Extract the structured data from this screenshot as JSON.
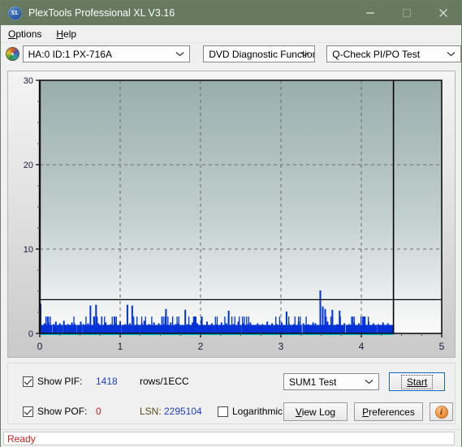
{
  "window": {
    "title": "PlexTools Professional XL V3.16",
    "icon": "xl-logo-icon",
    "minimize_label": "Minimize",
    "maximize_label": "Maximize",
    "close_label": "Close",
    "titlebar_color": "#67795F"
  },
  "menu": {
    "items": [
      {
        "label": "Options"
      },
      {
        "label": "Help"
      }
    ]
  },
  "selectors": {
    "drive_icon": "optical-disc-icon",
    "drive": {
      "value": "HA:0 ID:1  PX-716A"
    },
    "function": {
      "value": "DVD Diagnostic Functions"
    },
    "test": {
      "value": "Q-Check PI/PO Test"
    }
  },
  "chart_data": {
    "type": "bar",
    "title": "",
    "xlabel": "",
    "ylabel": "",
    "xlim": [
      0,
      5
    ],
    "ylim": [
      0,
      30
    ],
    "xticks": [
      0,
      1,
      2,
      3,
      4,
      5
    ],
    "xtick_labels": [
      "0",
      "1",
      "2",
      "3",
      "4",
      "5"
    ],
    "yticks": [
      0,
      10,
      20,
      30
    ],
    "ytick_labels": [
      "0",
      "10",
      "20",
      "30"
    ],
    "grid": true,
    "grid_style": "dashed",
    "bar_color": "#0032D8",
    "baseline_color": "#00C8D8",
    "threshold_line": {
      "value": 4,
      "color": "#000000"
    },
    "scan_end_marker": {
      "x": 4.4,
      "color": "#000000"
    },
    "series": [
      {
        "name": "PIF",
        "color": "#0032D8",
        "x": [
          0.01,
          0.03,
          0.06,
          0.09,
          0.11,
          0.14,
          0.17,
          0.2,
          0.22,
          0.25,
          0.27,
          0.3,
          0.32,
          0.35,
          0.37,
          0.4,
          0.43,
          0.45,
          0.48,
          0.51,
          0.54,
          0.57,
          0.6,
          0.63,
          0.65,
          0.68,
          0.7,
          0.73,
          0.76,
          0.79,
          0.82,
          0.85,
          0.88,
          0.91,
          0.94,
          0.97,
          1.0,
          1.03,
          1.06,
          1.09,
          1.12,
          1.15,
          1.18,
          1.21,
          1.24,
          1.27,
          1.3,
          1.33,
          1.36,
          1.39,
          1.42,
          1.45,
          1.48,
          1.51,
          1.54,
          1.57,
          1.6,
          1.63,
          1.66,
          1.69,
          1.72,
          1.75,
          1.78,
          1.81,
          1.84,
          1.87,
          1.9,
          1.93,
          1.96,
          1.99,
          2.02,
          2.05,
          2.08,
          2.11,
          2.14,
          2.17,
          2.2,
          2.23,
          2.26,
          2.29,
          2.32,
          2.35,
          2.38,
          2.41,
          2.44,
          2.47,
          2.5,
          2.53,
          2.56,
          2.59,
          2.62,
          2.65,
          2.68,
          2.71,
          2.74,
          2.77,
          2.8,
          2.83,
          2.86,
          2.89,
          2.92,
          2.95,
          2.98,
          3.01,
          3.04,
          3.07,
          3.1,
          3.13,
          3.16,
          3.19,
          3.22,
          3.25,
          3.28,
          3.31,
          3.34,
          3.37,
          3.4,
          3.43,
          3.46,
          3.49,
          3.52,
          3.55,
          3.58,
          3.61,
          3.64,
          3.67,
          3.7,
          3.73,
          3.76,
          3.79,
          3.82,
          3.85,
          3.88,
          3.91,
          3.94,
          3.97,
          4.0,
          4.03,
          4.06,
          4.09,
          4.12,
          4.15,
          4.18,
          4.21,
          4.24,
          4.27,
          4.3,
          4.33,
          4.36,
          4.39
        ],
        "values": [
          3.5,
          1,
          1.2,
          1,
          1.3,
          1,
          1.1,
          1.4,
          1,
          1.2,
          1,
          1.5,
          1,
          1.1,
          1,
          1.3,
          1.2,
          1,
          1,
          1.4,
          1.1,
          1,
          1.2,
          3.3,
          1,
          1.1,
          3.4,
          1.2,
          1,
          1,
          1.3,
          1,
          1.1,
          1,
          1.2,
          1,
          1.4,
          1,
          1.1,
          3.4,
          1.2,
          3.3,
          1,
          1.1,
          1,
          1.2,
          1.5,
          1,
          1.1,
          1,
          1.3,
          1,
          1.2,
          1,
          1.1,
          2.9,
          1,
          1.3,
          1,
          1.1,
          1.2,
          1,
          1,
          2.8,
          1.1,
          1,
          1.3,
          1,
          1.2,
          1,
          1.1,
          1,
          1.4,
          1,
          1.2,
          1,
          1.1,
          1,
          1.3,
          1,
          1.2,
          2.7,
          1,
          1.1,
          1,
          1.4,
          1,
          1.2,
          1,
          1.1,
          1.3,
          1,
          1,
          1.2,
          1,
          1.1,
          1,
          1.4,
          1,
          1.2,
          1,
          1.1,
          1,
          1.3,
          1,
          2.6,
          1.2,
          1,
          1.1,
          1,
          1.4,
          1,
          1.2,
          1,
          1.1,
          1,
          1.3,
          1.2,
          1,
          5.1,
          3.2,
          2.9,
          1.4,
          1,
          2.8,
          1,
          1.1,
          2.7,
          1,
          1.2,
          1,
          1.1,
          1,
          1.3,
          1,
          1.2,
          1,
          1.1,
          1,
          1.4,
          1,
          1.2,
          1,
          1.1,
          1,
          1.3,
          1,
          1.2
        ]
      }
    ]
  },
  "controls": {
    "show_pif": {
      "label": "Show PIF:",
      "checked": true,
      "value": "1418",
      "unit": "rows/1ECC"
    },
    "show_pof": {
      "label": "Show POF:",
      "checked": true,
      "value": "0"
    },
    "lsn": {
      "label": "LSN:",
      "value": "2295104"
    },
    "logarithmic": {
      "label": "Logarithmic",
      "checked": false
    },
    "test_select": {
      "value": "SUM1 Test"
    },
    "start_button": {
      "label": "Start",
      "focused": true
    },
    "view_log_button": {
      "label": "View Log"
    },
    "preferences_button": {
      "label": "Preferences"
    },
    "info_button": {
      "icon": "info-icon",
      "label": "i"
    }
  },
  "status": {
    "text": "Ready",
    "color": "#D02020"
  }
}
